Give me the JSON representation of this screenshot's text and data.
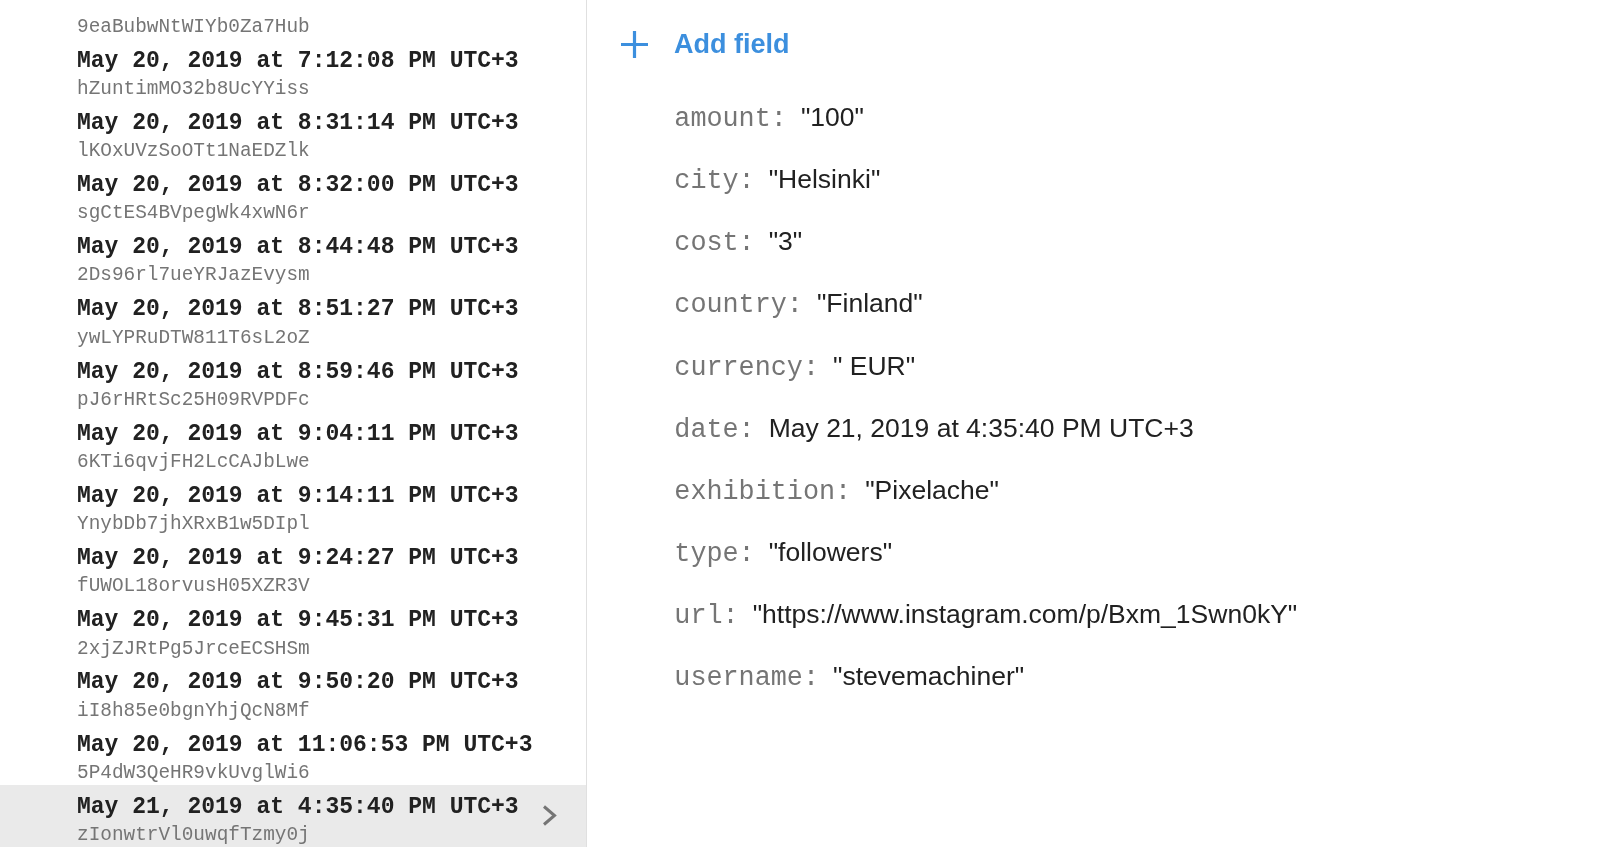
{
  "documents": [
    {
      "id": "9eaBubwNtWIYb0Za7Hub",
      "selected": false
    },
    {
      "title": "May 20, 2019 at 7:12:08 PM UTC+3",
      "id": "hZuntimMO32b8UcYYiss",
      "selected": false
    },
    {
      "title": "May 20, 2019 at 8:31:14 PM UTC+3",
      "id": "lKOxUVzSoOTt1NaEDZlk",
      "selected": false
    },
    {
      "title": "May 20, 2019 at 8:32:00 PM UTC+3",
      "id": "sgCtES4BVpegWk4xwN6r",
      "selected": false
    },
    {
      "title": "May 20, 2019 at 8:44:48 PM UTC+3",
      "id": "2Ds96rl7ueYRJazEvysm",
      "selected": false
    },
    {
      "title": "May 20, 2019 at 8:51:27 PM UTC+3",
      "id": "ywLYPRuDTW811T6sL2oZ",
      "selected": false
    },
    {
      "title": "May 20, 2019 at 8:59:46 PM UTC+3",
      "id": "pJ6rHRtSc25H09RVPDFc",
      "selected": false
    },
    {
      "title": "May 20, 2019 at 9:04:11 PM UTC+3",
      "id": "6KTi6qvjFH2LcCAJbLwe",
      "selected": false
    },
    {
      "title": "May 20, 2019 at 9:14:11 PM UTC+3",
      "id": "YnybDb7jhXRxB1w5DIpl",
      "selected": false
    },
    {
      "title": "May 20, 2019 at 9:24:27 PM UTC+3",
      "id": "fUWOL18orvusH05XZR3V",
      "selected": false
    },
    {
      "title": "May 20, 2019 at 9:45:31 PM UTC+3",
      "id": "2xjZJRtPg5JrceECSHSm",
      "selected": false
    },
    {
      "title": "May 20, 2019 at 9:50:20 PM UTC+3",
      "id": "iI8h85e0bgnYhjQcN8Mf",
      "selected": false
    },
    {
      "title": "May 20, 2019 at 11:06:53 PM UTC+3",
      "id": "5P4dW3QeHR9vkUvglWi6",
      "selected": false
    },
    {
      "title": "May 21, 2019 at 4:35:40 PM UTC+3",
      "id": "zIonwtrVl0uwqfTzmy0j",
      "selected": true
    }
  ],
  "add_field": {
    "label": "Add field"
  },
  "fields": [
    {
      "key": "amount:",
      "value": "\"100\""
    },
    {
      "key": "city:",
      "value": "\"Helsinki\""
    },
    {
      "key": "cost:",
      "value": "\"3\""
    },
    {
      "key": "country:",
      "value": "\"Finland\""
    },
    {
      "key": "currency:",
      "value": "\" EUR\""
    },
    {
      "key": "date:",
      "value": "May 21, 2019 at 4:35:40 PM UTC+3"
    },
    {
      "key": "exhibition:",
      "value": "\"Pixelache\""
    },
    {
      "key": "type:",
      "value": "\"followers\""
    },
    {
      "key": "url:",
      "value": "\"https://www.instagram.com/p/Bxm_1Swn0kY\""
    },
    {
      "key": "username:",
      "value": "\"stevemachiner\""
    }
  ]
}
